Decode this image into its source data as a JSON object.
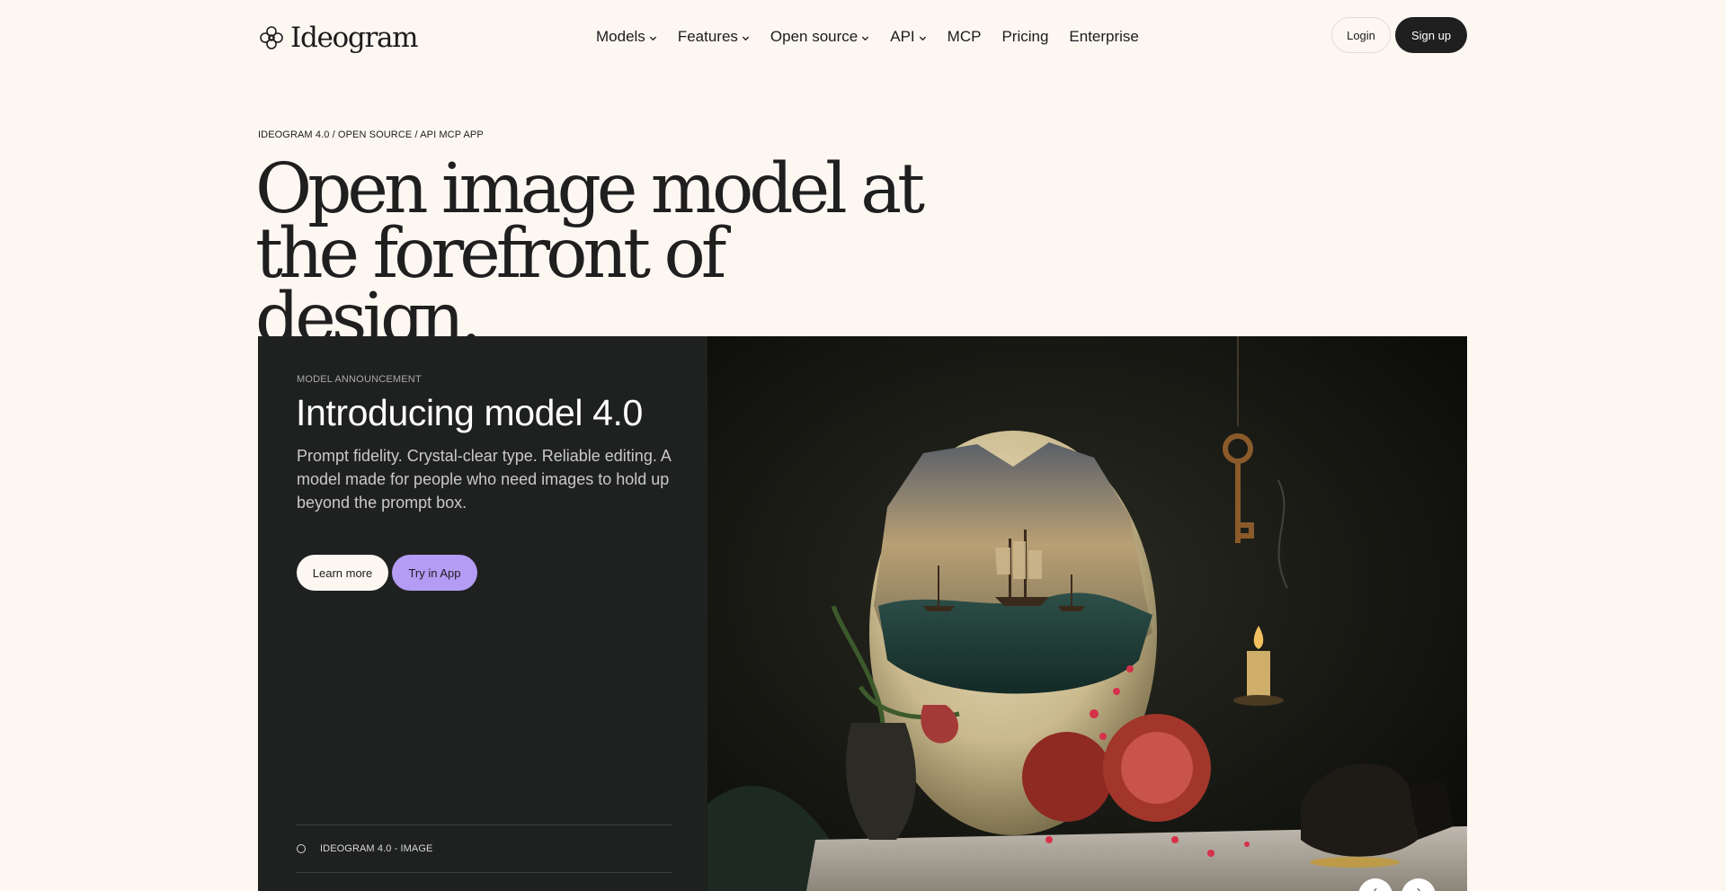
{
  "brand": {
    "name": "Ideogram"
  },
  "nav": {
    "items": [
      {
        "label": "Models",
        "dropdown": true
      },
      {
        "label": "Features",
        "dropdown": true
      },
      {
        "label": "Open source",
        "dropdown": true
      },
      {
        "label": "API",
        "dropdown": true
      },
      {
        "label": "MCP",
        "dropdown": false
      },
      {
        "label": "Pricing",
        "dropdown": false
      },
      {
        "label": "Enterprise",
        "dropdown": false
      }
    ],
    "login_label": "Login",
    "signup_label": "Sign up"
  },
  "hero": {
    "breadcrumb": [
      "IDEOGRAM 4.0",
      "OPEN SOURCE",
      "API MCP APP"
    ],
    "breadcrumb_separator": "/",
    "title_line1": "Open image model at",
    "title_line2": "the forefront of design."
  },
  "card": {
    "eyebrow": "MODEL ANNOUNCEMENT",
    "title": "Introducing model 4.0",
    "description": "Prompt fidelity. Crystal-clear type. Reliable editing. A model made for people who need images to hold up beyond the prompt box.",
    "learn_more_label": "Learn more",
    "try_label": "Try in App",
    "models": [
      {
        "label": "IDEOGRAM 4.0 - IMAGE"
      }
    ],
    "carousel": {
      "prev_icon": "chevron-left-icon",
      "next_icon": "chevron-right-icon"
    }
  },
  "colors": {
    "page_bg": "#fdf7f2",
    "ink": "#1c1c1c",
    "card_bg": "#1f2020",
    "accent_purple": "#b49bf4"
  }
}
